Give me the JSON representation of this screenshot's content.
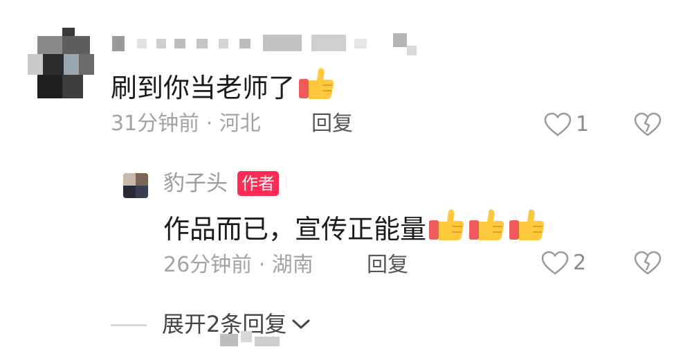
{
  "comment": {
    "username_obscured": true,
    "text": "刷到你当老师了",
    "emoji": "👍",
    "time": "31分钟前",
    "location": "河北",
    "meta_separator": " · ",
    "reply_label": "回复",
    "like_count": "1"
  },
  "reply": {
    "username": "豹子头",
    "badge": "作者",
    "text": "作品而已，宣传正能量",
    "emojis": [
      "👍",
      "👍",
      "👍"
    ],
    "time": "26分钟前",
    "location": "湖南",
    "meta_separator": " · ",
    "reply_label": "回复",
    "like_count": "2"
  },
  "expand": {
    "label": "展开2条回复",
    "chevron": "chevron-down-icon"
  },
  "colors": {
    "badge_bg": "#fe2c55",
    "meta_gray": "#a3a3a3",
    "thumb_yellow": "#ffc83d",
    "thumb_sleeve": "#f05a5a"
  }
}
